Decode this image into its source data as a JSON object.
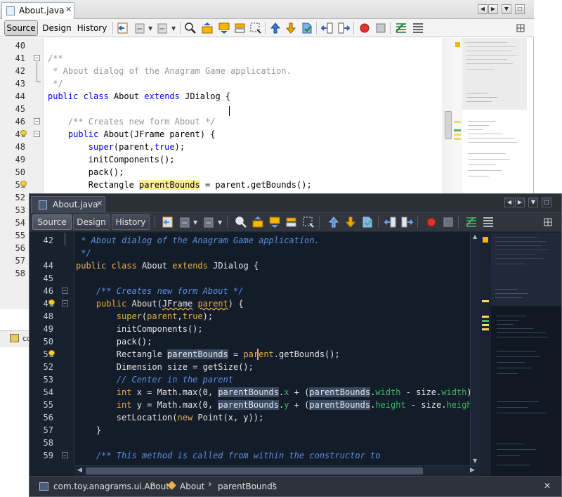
{
  "light": {
    "tab_title": "About.java",
    "views": [
      "Source",
      "Design",
      "History"
    ],
    "line_numbers": [
      "40",
      "41",
      "42",
      "43",
      "44",
      "45",
      "46",
      "47",
      "48",
      "49",
      "50",
      "51",
      "52",
      "53",
      "54",
      "55",
      "56",
      "57",
      "58"
    ],
    "bottom_label": "co"
  },
  "dark": {
    "tab_title": "About.java",
    "views": [
      "Source",
      "Design",
      "History"
    ],
    "line_numbers": [
      "42",
      "44",
      "45",
      "46",
      "47",
      "48",
      "49",
      "50",
      "51",
      "52",
      "53",
      "54",
      "55",
      "56",
      "57",
      "58",
      "59"
    ],
    "breadcrumb": {
      "package": "com.toy.anagrams.ui.About",
      "class": "About",
      "field": "parentBounds"
    }
  },
  "colors": {
    "light_keyword": "#0000e6",
    "light_comment": "#969696",
    "dark_keyword": "#e8b04a",
    "dark_comment": "#5b8fe0",
    "dark_field": "#3fb964",
    "occurrence_light": "#fbf096",
    "occurrence_dark": "#3a4a62"
  },
  "icons": [
    "document-icon",
    "close-icon",
    "nav-left-icon",
    "nav-right-icon",
    "dropdown-icon",
    "maximize-icon",
    "back-icon",
    "forward-icon",
    "search-icon",
    "find-previous-icon",
    "find-next-icon",
    "toggle-highlight-icon",
    "rectangular-selection-icon",
    "previous-bookmark-icon",
    "next-bookmark-icon",
    "toggle-bookmark-icon",
    "shift-left-icon",
    "shift-right-icon",
    "record-macro-icon",
    "stop-macro-icon",
    "comment-icon",
    "uncomment-icon",
    "lightbulb-icon",
    "fold-icon",
    "package-icon",
    "class-icon",
    "chevron-right-icon"
  ]
}
